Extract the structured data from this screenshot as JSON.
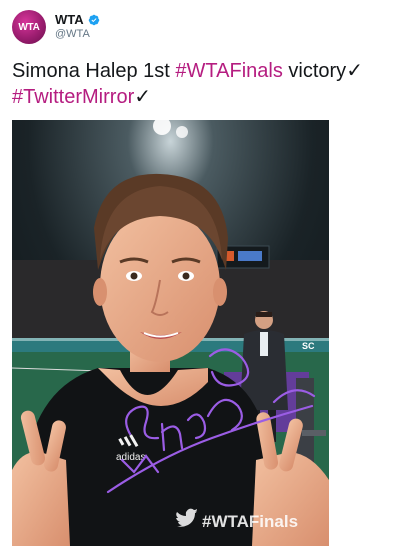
{
  "author": {
    "avatar_text": "WTA",
    "display_name": "WTA",
    "handle": "@WTA",
    "verified": true,
    "avatar_color": "#9b1d6f",
    "verified_color": "#1da1f2"
  },
  "tweet": {
    "text_part1": "Simona Halep 1st ",
    "hashtag1": "#WTAFinals",
    "text_part2": " victory",
    "check1": "✓",
    "hashtag2": "#TwitterMirror",
    "check2": "✓",
    "hashtag_color": "#b51d80"
  },
  "media": {
    "watermark": "#WTAFinals",
    "shirt_brand": "adidas",
    "watermark_icon": "twitter-bird-icon",
    "court_text": "SC"
  }
}
